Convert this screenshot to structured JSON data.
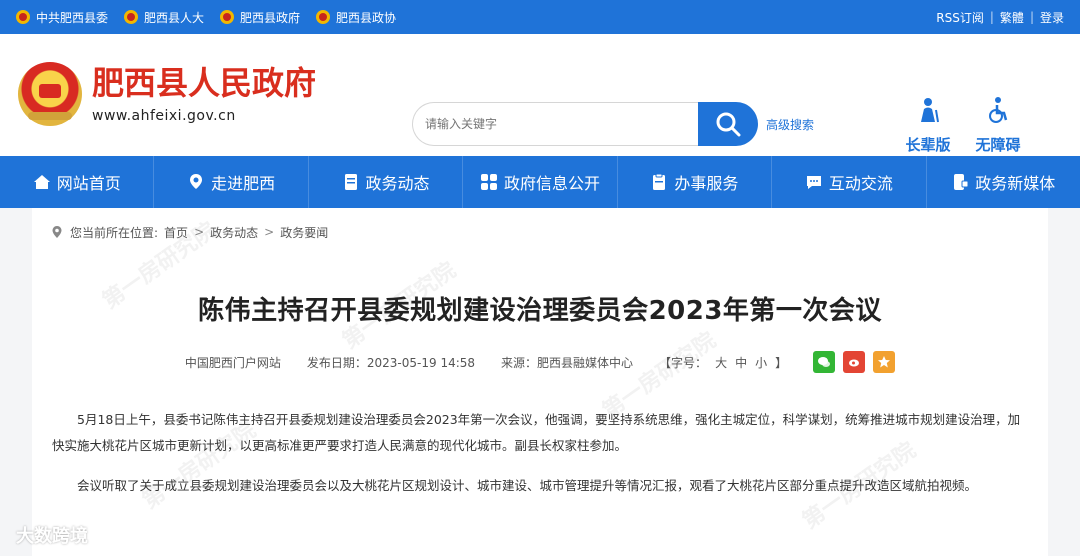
{
  "topbar": {
    "links": [
      "中共肥西县委",
      "肥西县人大",
      "肥西县政府",
      "肥西县政协"
    ],
    "right": [
      "RSS订阅",
      "繁體",
      "登录"
    ]
  },
  "header": {
    "site_name": "肥西县人民政府",
    "site_url": "www.ahfeixi.gov.cn",
    "search_placeholder": "请输入关键字",
    "advanced_search": "高级搜索",
    "modes": {
      "elder": "长辈版",
      "accessible": "无障碍"
    }
  },
  "nav": {
    "items": [
      "网站首页",
      "走进肥西",
      "政务动态",
      "政府信息公开",
      "办事服务",
      "互动交流",
      "政务新媒体"
    ]
  },
  "breadcrumb": {
    "label": "您当前所在位置:",
    "items": [
      "首页",
      "政务动态",
      "政务要闻"
    ]
  },
  "article": {
    "title": "陈伟主持召开县委规划建设治理委员会2023年第一次会议",
    "meta": {
      "site": "中国肥西门户网站",
      "date": "发布日期：2023-05-19 14:58",
      "source": "来源：肥西县融媒体中心",
      "font_label": "【字号：",
      "font_sizes": [
        "大",
        "中",
        "小"
      ],
      "font_suffix": "】"
    },
    "paragraphs": [
      "5月18日上午，县委书记陈伟主持召开县委规划建设治理委员会2023年第一次会议，他强调，要坚持系统思维，强化主城定位，科学谋划，统筹推进城市规划建设治理，加快实施大桃花片区城市更新计划，以更高标准更严要求打造人民满意的现代化城市。副县长权家柱参加。",
      "会议听取了关于成立县委规划建设治理委员会以及大桃花片区规划设计、城市建设、城市管理提升等情况汇报，观看了大桃花片区部分重点提升改造区域航拍视频。"
    ]
  },
  "watermark_text": "第一房研究院",
  "bottom_mark": "大数跨境"
}
